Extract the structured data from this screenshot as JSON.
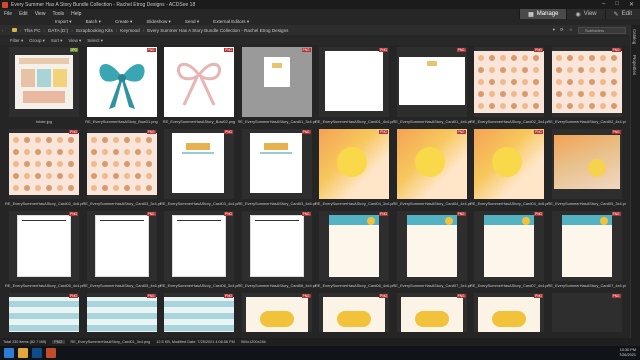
{
  "window": {
    "title": "Every Summer Has A Story Bundle Collection - Rachel Etrog Designs - ACDSee 18",
    "controls": [
      "–",
      "□",
      "✕"
    ]
  },
  "menu": [
    "File",
    "Edit",
    "View",
    "Tools",
    "Help"
  ],
  "toolbar": [
    "Import ▾",
    "Batch ▾",
    "Create ▾",
    "Slideshow ▾",
    "Send ▾",
    "External Editors ▾"
  ],
  "modes": [
    {
      "label": "Manage",
      "icon": "grid-icon",
      "active": true
    },
    {
      "label": "View",
      "icon": "eye-icon",
      "active": false
    },
    {
      "label": "Edit",
      "icon": "edit-icon",
      "active": false
    }
  ],
  "breadcrumb": [
    "This PC",
    "DATA (D:)",
    "Scrapbooking Kits",
    "Keymood",
    "Every Summer Has A Story Bundle Collection - Rachel Etrog Designs"
  ],
  "search": {
    "placeholder": "Subfolders"
  },
  "filterbar": [
    "Filter ▾",
    "Group ▾",
    "Sort ▾",
    "View ▾",
    "Select ▾"
  ],
  "side_tabs": [
    "Catalog",
    "Properties"
  ],
  "files": [
    {
      "name": "folder.jpg",
      "badge": "JPG",
      "art": "folderpreview"
    },
    {
      "name": "RE_EverySummerHasAStory_Bow01.png",
      "badge": "PNG",
      "art": "tealbow"
    },
    {
      "name": "RE_EverySummerHasAStory_Bow02.png",
      "badge": "PNG",
      "art": "pinkbow"
    },
    {
      "name": "RE_EverySummerHasAStory_Card01_3x4.png",
      "badge": "PNG",
      "art": "card-small",
      "selected": true
    },
    {
      "name": "RE_EverySummerHasAStory_Card01_4x4.png",
      "badge": "PNG",
      "art": "card-white"
    },
    {
      "name": "RE_EverySummerHasAStory_Card01_4x6.png",
      "badge": "PNG",
      "art": "card-wide"
    },
    {
      "name": "RE_EverySummerHasAStory_Card02_3x4.png",
      "badge": "PNG",
      "art": "pattern"
    },
    {
      "name": "RE_EverySummerHasAStory_Card02_4x4.png",
      "badge": "PNG",
      "art": "pattern"
    },
    {
      "name": "RE_EverySummerHasAStory_Card02_4x6.png",
      "badge": "PNG",
      "art": "pattern"
    },
    {
      "name": "RE_EverySummerHasAStory_Card03_3x4.png",
      "badge": "PNG",
      "art": "pattern"
    },
    {
      "name": "RE_EverySummerHasAStory_Card03_4x4.png",
      "badge": "PNG",
      "art": "summer"
    },
    {
      "name": "RE_EverySummerHasAStory_Card03_4x6.png",
      "badge": "PNG",
      "art": "summer"
    },
    {
      "name": "RE_EverySummerHasAStory_Card04_3x4.png",
      "badge": "PNG",
      "art": "sunsplash"
    },
    {
      "name": "RE_EverySummerHasAStory_Card04_4x4.png",
      "badge": "PNG",
      "art": "sunsplash"
    },
    {
      "name": "RE_EverySummerHasAStory_Card04_4x6.png",
      "badge": "PNG",
      "art": "sunsplash"
    },
    {
      "name": "RE_EverySummerHasAStory_Card05_3x4.png",
      "badge": "PNG",
      "art": "sunset"
    },
    {
      "name": "RE_EverySummerHasAStory_Card05_4x4.png",
      "badge": "PNG",
      "art": "storyby"
    },
    {
      "name": "RE_EverySummerHasAStory_Card05_4x6.png",
      "badge": "PNG",
      "art": "storyby"
    },
    {
      "name": "RE_EverySummerHasAStory_Card06_3x4.png",
      "badge": "PNG",
      "art": "storyby"
    },
    {
      "name": "RE_EverySummerHasAStory_Card06_4x4.png",
      "badge": "PNG",
      "art": "storyby"
    },
    {
      "name": "RE_EverySummerHasAStory_Card06_4x6.png",
      "badge": "PNG",
      "art": "bucket"
    },
    {
      "name": "RE_EverySummerHasAStory_Card07_3x4.png",
      "badge": "PNG",
      "art": "bucket"
    },
    {
      "name": "RE_EverySummerHasAStory_Card07_4x4.png",
      "badge": "PNG",
      "art": "bucket"
    },
    {
      "name": "RE_EverySummerHasAStory_Card07_4x6.png",
      "badge": "PNG",
      "art": "bucket"
    },
    {
      "name": "",
      "badge": "PNG",
      "art": "everystory"
    },
    {
      "name": "",
      "badge": "PNG",
      "art": "everystory"
    },
    {
      "name": "",
      "badge": "PNG",
      "art": "everystory"
    },
    {
      "name": "",
      "badge": "PNG",
      "art": "vibes"
    },
    {
      "name": "",
      "badge": "PNG",
      "art": "vibes"
    },
    {
      "name": "",
      "badge": "PNG",
      "art": "vibes"
    },
    {
      "name": "",
      "badge": "PNG",
      "art": "vibes"
    },
    {
      "name": "",
      "badge": "PNG",
      "art": "dark"
    }
  ],
  "status": {
    "total": "Total 230 items (82.7 MB)",
    "format": "PNG",
    "file": "RE_EverySummerHasAStory_Card01_3x4.png",
    "size": "12.5 KB, Modified Date: 7/25/2021 4:08:56 PM",
    "dims": "900x1200x24b"
  },
  "clock": {
    "time": "10:30 PM",
    "date": "7/26/2021"
  },
  "colors": {
    "accent": "#4a4a4a",
    "png_badge": "#b03434",
    "jpg_badge": "#6a8f2a"
  }
}
